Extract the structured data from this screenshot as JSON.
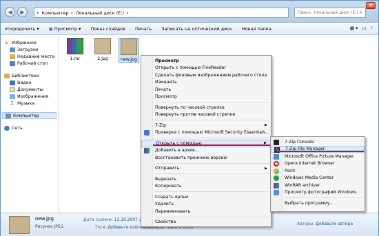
{
  "address": {
    "computer": "Компьютер",
    "disk": "Локальный диск (E:)"
  },
  "search_placeholder": "Поиск: Локальный диск (E:)",
  "toolbar": [
    "Упорядочить",
    "Просмотр",
    "Показ слайдов",
    "Печать",
    "Записать на оптический диск",
    "Новая папка"
  ],
  "nav": {
    "favorites": "Избранное",
    "favorites_items": [
      "Загрузки",
      "Недавние места",
      "Рабочий стол"
    ],
    "libraries": "Библиотеки",
    "libraries_items": [
      "Видео",
      "Документы",
      "Изображения",
      "Музыка"
    ],
    "computer": "Компьютер",
    "network": "Сеть"
  },
  "files": [
    "1.rar",
    "2.jpg",
    "new.jpg"
  ],
  "context_menu": [
    "Просмотр",
    "Открыть с помощью FineReader",
    "Сделать фоновым изображением рабочего стола",
    "Изменить",
    "Печать",
    "Просмотр",
    "Повернуть по часовой стрелке",
    "Повернуть против часовой стрелки",
    "7-Zip",
    "Проверка с помощью Microsoft Security Essentials...",
    "Открыть с помощью",
    "Добавить в архив...",
    "Восстановить прежнюю версию",
    "Отправить",
    "Вырезать",
    "Копировать",
    "Создать ярлык",
    "Удалить",
    "Переименовать",
    "Свойства"
  ],
  "submenu": [
    "7-Zip Console",
    "7-Zip File Manager",
    "Microsoft Office Picture Manager",
    "Opera Internet Browser",
    "Paint",
    "Windows Media Center",
    "WinRAR archiver",
    "Просмотр фотографий Windows",
    "Выбрать программу..."
  ],
  "details": {
    "name": "new.jpg",
    "type": "Рисунок JPEG",
    "date_label": "Дата съемки:",
    "date_value": "13.10.2007 22:04",
    "tags_label": "Теги:",
    "tags_value": "Добавьте ключевое сл...",
    "size_label": "Размеры:",
    "size_value": "1900 x 1200",
    "author_label": "Авторы:",
    "author_value": "Добавьте автора"
  }
}
